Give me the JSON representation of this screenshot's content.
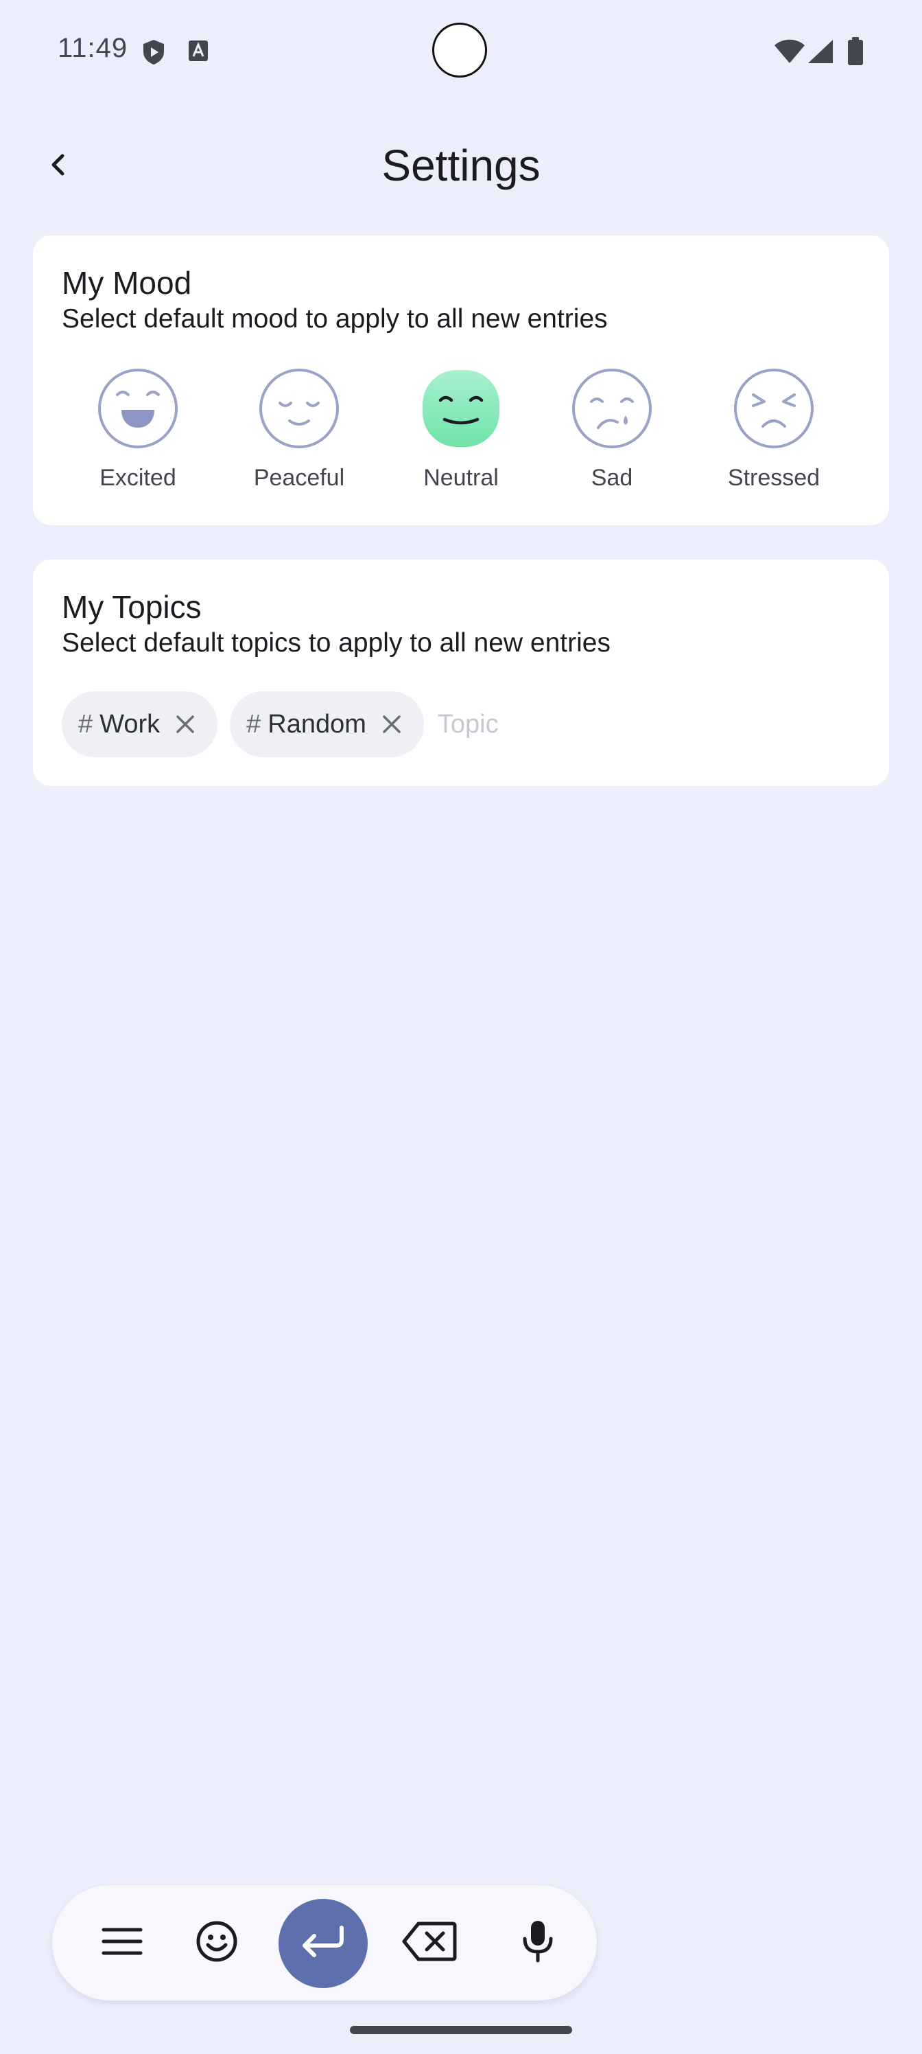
{
  "status_bar": {
    "time": "11:49",
    "icons": [
      "shield-play-icon",
      "text-a-icon",
      "wifi-icon",
      "cell-signal-icon",
      "battery-icon"
    ]
  },
  "header": {
    "title": "Settings",
    "back_icon": "chevron-left-icon"
  },
  "mood_card": {
    "title": "My Mood",
    "subtitle": "Select default mood to apply to all new entries",
    "moods": [
      {
        "label": "Excited",
        "icon": "excited-face-icon",
        "selected": false
      },
      {
        "label": "Peaceful",
        "icon": "peaceful-face-icon",
        "selected": false
      },
      {
        "label": "Neutral",
        "icon": "neutral-face-icon",
        "selected": true
      },
      {
        "label": "Sad",
        "icon": "sad-face-icon",
        "selected": false
      },
      {
        "label": "Stressed",
        "icon": "stressed-face-icon",
        "selected": false
      }
    ]
  },
  "topics_card": {
    "title": "My Topics",
    "subtitle": "Select default topics to apply to all new entries",
    "chips": [
      {
        "prefix": "#",
        "label": "Work"
      },
      {
        "prefix": "#",
        "label": "Random"
      }
    ],
    "input": {
      "placeholder": "Topic",
      "value": ""
    }
  },
  "keyboard_toolbar": {
    "buttons": [
      "menu-icon",
      "emoji-icon",
      "enter-icon",
      "backspace-icon",
      "microphone-icon"
    ]
  },
  "colors": {
    "background": "#eceefc",
    "card": "#ffffff",
    "accent": "#5d70ad",
    "mood_outline": "#9aa3c7",
    "neutral_selected": "#7ee8b2"
  }
}
